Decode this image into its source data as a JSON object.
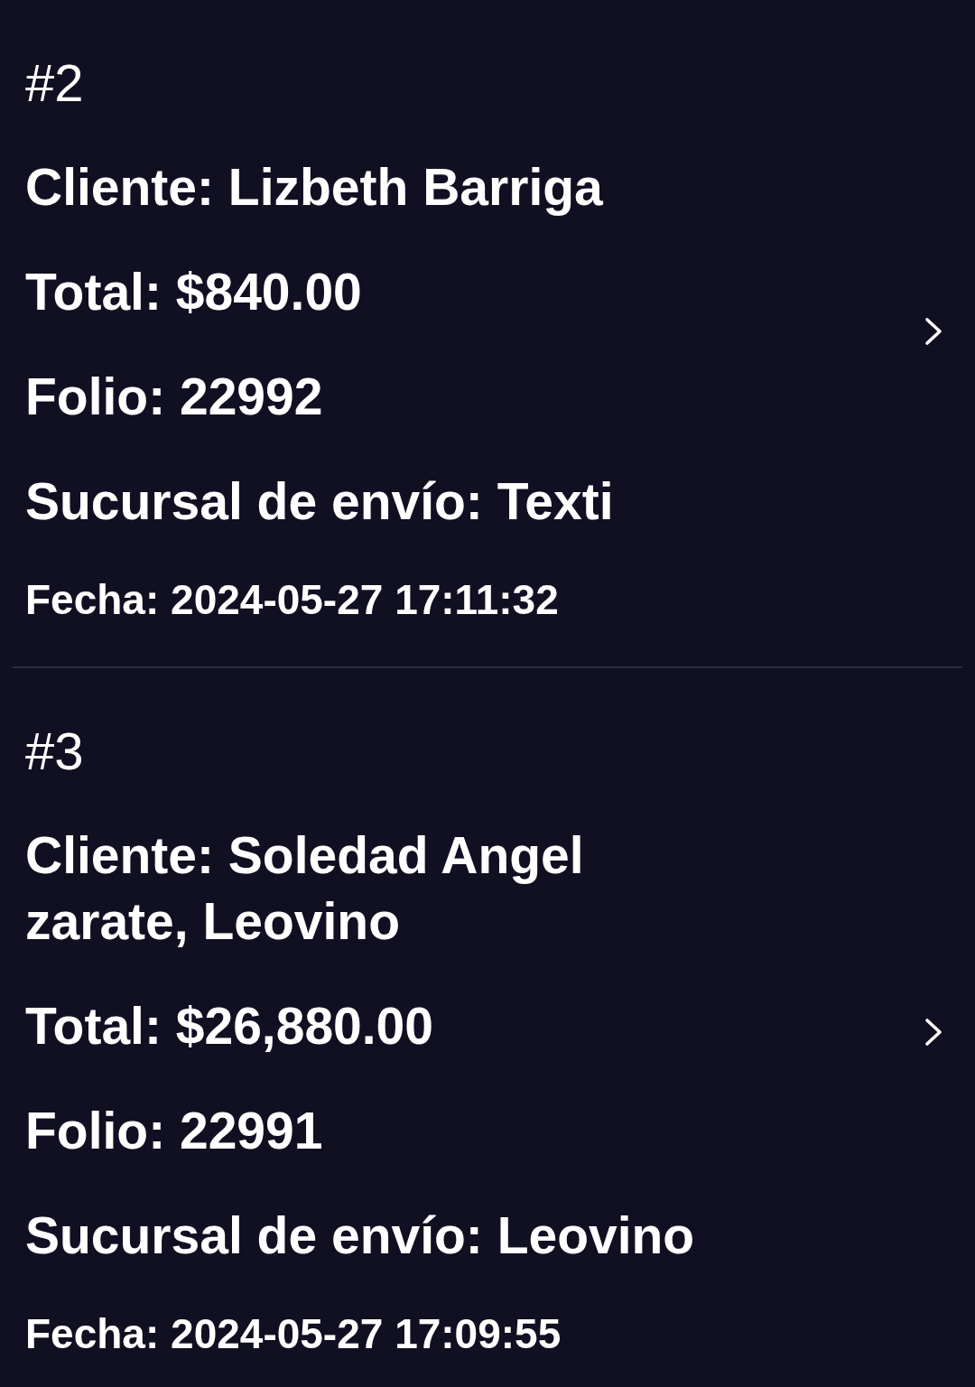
{
  "orders": [
    {
      "number": "#2",
      "client": "Cliente: Lizbeth Barriga",
      "total": "Total: $840.00",
      "folio": "Folio: 22992",
      "branch": "Sucursal de envío: Texti",
      "date": "Fecha: 2024-05-27 17:11:32"
    },
    {
      "number": "#3",
      "client": "Cliente: Soledad Angel zarate, Leovino",
      "total": "Total: $26,880.00",
      "folio": "Folio: 22991",
      "branch": "Sucursal de envío: Leovino",
      "date": "Fecha: 2024-05-27 17:09:55"
    }
  ]
}
